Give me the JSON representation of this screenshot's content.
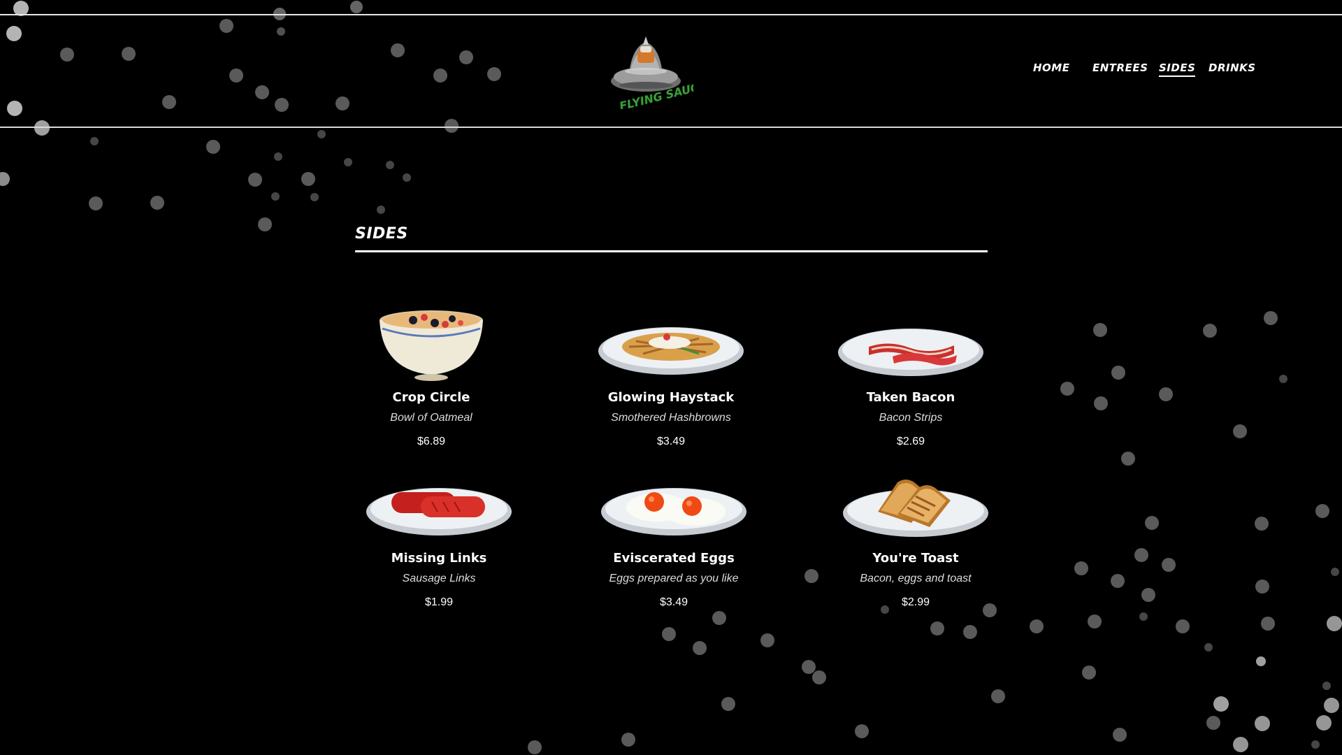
{
  "brand": {
    "logo_text": "FLYING SAUCER",
    "logo_color": "#3da33a"
  },
  "nav": {
    "items": [
      {
        "label": "HOME",
        "active": false
      },
      {
        "label": "ENTREES",
        "active": false
      },
      {
        "label": "SIDES",
        "active": true
      },
      {
        "label": "DRINKS",
        "active": false
      }
    ]
  },
  "section": {
    "title": "SIDES"
  },
  "menu": [
    {
      "name": "Crop Circle",
      "description": "Bowl of Oatmeal",
      "price": "$6.89",
      "icon": "oatmeal-bowl-icon"
    },
    {
      "name": "Glowing Haystack",
      "description": "Smothered Hashbrowns",
      "price": "$3.49",
      "icon": "hashbrowns-plate-icon"
    },
    {
      "name": "Taken Bacon",
      "description": "Bacon Strips",
      "price": "$2.69",
      "icon": "bacon-plate-icon"
    },
    {
      "name": "Missing Links",
      "description": "Sausage Links",
      "price": "$1.99",
      "icon": "sausage-plate-icon"
    },
    {
      "name": "Eviscerated Eggs",
      "description": "Eggs prepared as you like",
      "price": "$3.49",
      "icon": "eggs-plate-icon"
    },
    {
      "name": "You're Toast",
      "description": "Bacon, eggs and toast",
      "price": "$2.99",
      "icon": "toast-plate-icon"
    }
  ],
  "colors": {
    "background": "#000000",
    "text": "#ffffff",
    "bubble": "#9a9a9a"
  }
}
